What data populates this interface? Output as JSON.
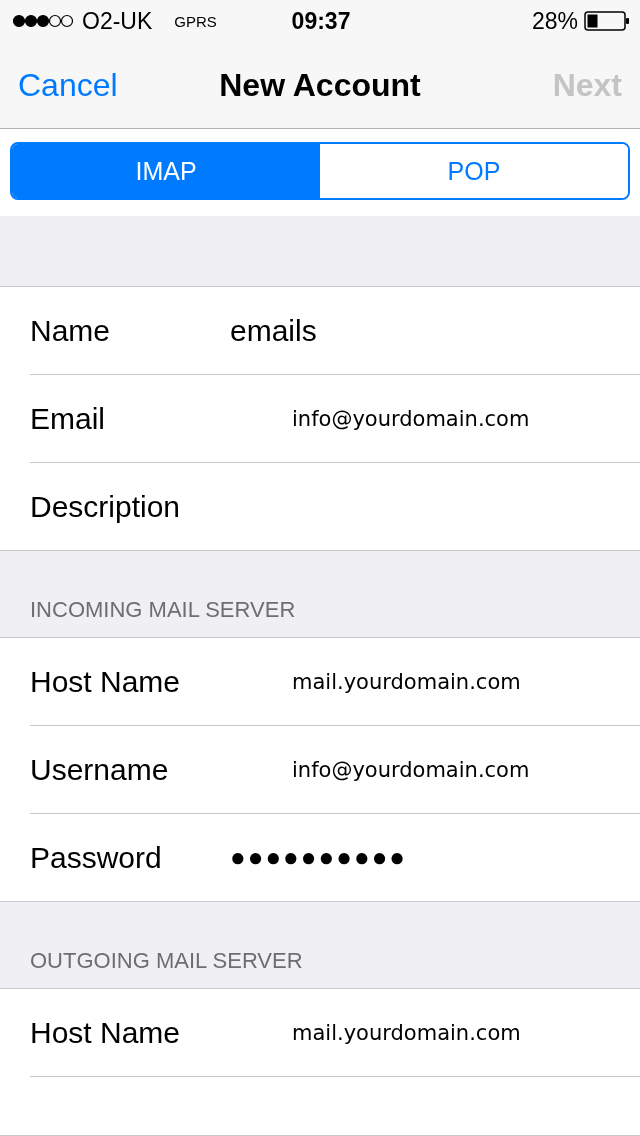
{
  "status_bar": {
    "carrier": "O2-UK",
    "network": "GPRS",
    "time": "09:37",
    "battery": "28%"
  },
  "nav_bar": {
    "cancel": "Cancel",
    "title": "New Account",
    "next": {
      "label": "Next",
      "disabled": true
    }
  },
  "segments": [
    {
      "label": "IMAP",
      "selected": true
    },
    {
      "label": "POP",
      "selected": false
    }
  ],
  "sections": [
    {
      "rows": [
        {
          "label": "Name",
          "value": "emails",
          "kind": "plain"
        },
        {
          "label": "Email",
          "value": "info@yourdomain.com",
          "kind": "typed"
        },
        {
          "label": "Description",
          "kind": "plain"
        }
      ]
    },
    {
      "header": "INCOMING MAIL SERVER",
      "rows": [
        {
          "label": "Host Name",
          "value": "mail.yourdomain.com",
          "kind": "typed"
        },
        {
          "label": "Username",
          "value": "info@yourdomain.com",
          "kind": "typed"
        },
        {
          "label": "Password",
          "value": "●●●●●●●●●●",
          "kind": "secure"
        }
      ]
    },
    {
      "header": "OUTGOING MAIL SERVER",
      "rows": [
        {
          "label": "Host Name",
          "value": "mail.yourdomain.com",
          "kind": "typed"
        }
      ]
    }
  ]
}
